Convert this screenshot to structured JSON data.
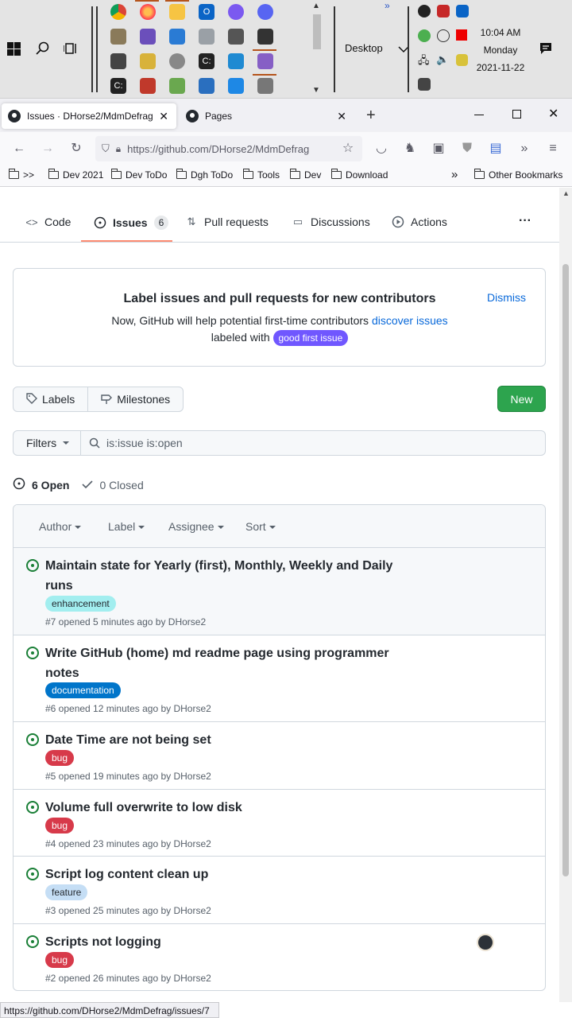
{
  "taskbar": {
    "desktop_label": "Desktop",
    "time": "10:04 AM",
    "day": "Monday",
    "date": "2021-11-22"
  },
  "tabs": [
    {
      "title": "Issues · DHorse2/MdmDefrag"
    },
    {
      "title": "Pages"
    }
  ],
  "url": "https://github.com/DHorse2/MdmDefrag",
  "bookmarks": [
    ">>",
    "Dev 2021",
    "Dev ToDo",
    "Dgh ToDo",
    "Tools",
    "Dev",
    "Download",
    "Other Bookmarks"
  ],
  "reponav": {
    "code": "Code",
    "issues": "Issues",
    "issues_count": "6",
    "pulls": "Pull requests",
    "discussions": "Discussions",
    "actions": "Actions",
    "more": "···"
  },
  "banner": {
    "title": "Label issues and pull requests for new contributors",
    "text_before": "Now, GitHub will help potential first-time contributors ",
    "link": "discover issues",
    "text_after": "labeled with ",
    "label": "good first issue",
    "dismiss": "Dismiss"
  },
  "buttons": {
    "labels": "Labels",
    "milestones": "Milestones",
    "new": "New"
  },
  "filter": {
    "button": "Filters",
    "query": "is:issue is:open"
  },
  "counts": {
    "open": "6 Open",
    "closed": "0 Closed"
  },
  "issues_header": {
    "author": "Author",
    "label": "Label",
    "assignee": "Assignee",
    "sort": "Sort"
  },
  "issues": [
    {
      "title": "Maintain state for Yearly (first), Monthly, Weekly and Daily runs",
      "label": "enhancement",
      "label_bg": "#a2eeef",
      "label_fg": "#24292f",
      "meta": "#7 opened 5 minutes ago by DHorse2"
    },
    {
      "title": "Write GitHub (home) md readme page using programmer notes",
      "label": "documentation",
      "label_bg": "#0075ca",
      "label_fg": "#ffffff",
      "meta": "#6 opened 12 minutes ago by DHorse2"
    },
    {
      "title": "Date Time are not being set",
      "label": "bug",
      "label_bg": "#d73a4a",
      "label_fg": "#ffffff",
      "meta": "#5 opened 19 minutes ago by DHorse2"
    },
    {
      "title": "Volume full overwrite to low disk",
      "label": "bug",
      "label_bg": "#d73a4a",
      "label_fg": "#ffffff",
      "meta": "#4 opened 23 minutes ago by DHorse2"
    },
    {
      "title": "Script log content clean up",
      "label": "feature",
      "label_bg": "#c5def5",
      "label_fg": "#24292f",
      "meta": "#3 opened 25 minutes ago by DHorse2"
    },
    {
      "title": "Scripts not logging",
      "label": "bug",
      "label_bg": "#d73a4a",
      "label_fg": "#ffffff",
      "meta": "#2 opened 26 minutes ago by DHorse2"
    }
  ],
  "status_url": "https://github.com/DHorse2/MdmDefrag/issues/7"
}
